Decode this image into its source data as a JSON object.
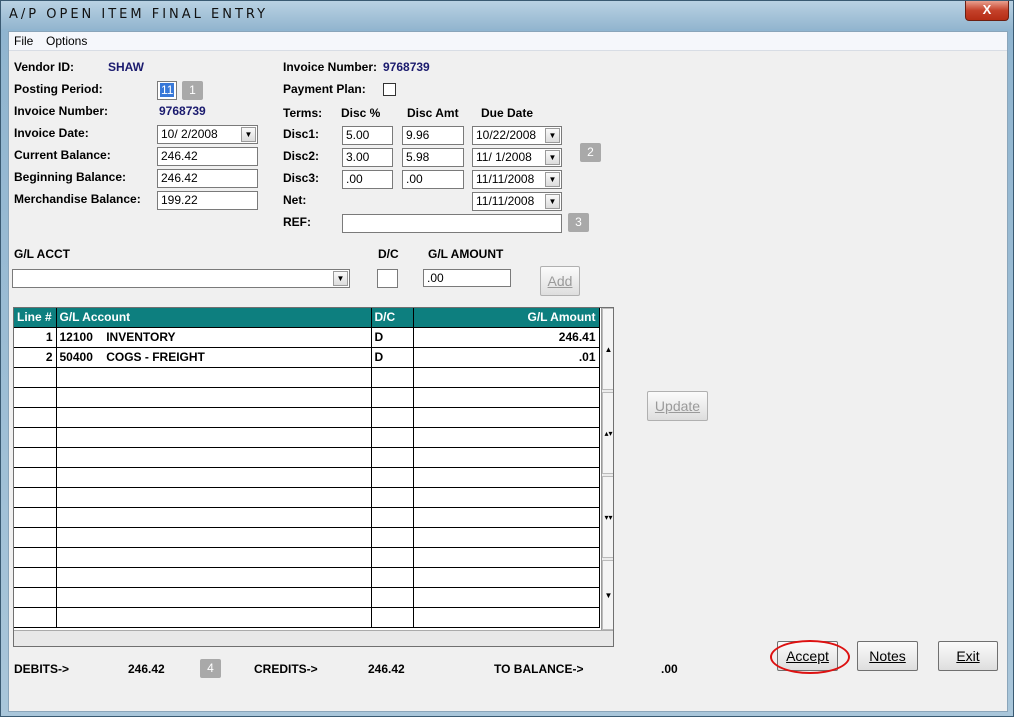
{
  "window": {
    "title": "A/P  OPEN ITEM FINAL ENTRY",
    "close_glyph": "X"
  },
  "menu": [
    "File",
    "Options"
  ],
  "header": {
    "vendor_id_label": "Vendor ID:",
    "vendor_id": "SHAW",
    "posting_period_label": "Posting Period:",
    "posting_period": "11",
    "invoice_number_label": "Invoice Number:",
    "invoice_number": "9768739",
    "invoice_date_label": "Invoice Date:",
    "invoice_date": "10/ 2/2008",
    "current_balance_label": "Current Balance:",
    "current_balance": "246.42",
    "beginning_balance_label": "Beginning Balance:",
    "beginning_balance": "246.42",
    "merch_balance_label": "Merchandise Balance:",
    "merch_balance": "199.22",
    "invoice_number_label_2": "Invoice Number:",
    "invoice_number_2": "9768739",
    "payment_plan_label": "Payment Plan:"
  },
  "terms": {
    "terms_label": "Terms:",
    "disc_pct_label": "Disc %",
    "disc_amt_label": "Disc Amt",
    "due_date_label": "Due Date",
    "rows": [
      {
        "label": "Disc1:",
        "pct": "5.00",
        "amt": "9.96",
        "due": "10/22/2008"
      },
      {
        "label": "Disc2:",
        "pct": "3.00",
        "amt": "5.98",
        "due": "11/ 1/2008"
      },
      {
        "label": "Disc3:",
        "pct": ".00",
        "amt": ".00",
        "due": "11/11/2008"
      }
    ],
    "net_label": "Net:",
    "net_due": "11/11/2008",
    "ref_label": "REF:",
    "ref_value": ""
  },
  "badges": [
    "1",
    "2",
    "3",
    "4"
  ],
  "gl_entry": {
    "acct_label": "G/L ACCT",
    "dc_label": "D/C",
    "amount_label": "G/L AMOUNT",
    "acct_value": "",
    "dc_value": "",
    "amount_value": ".00",
    "add_label": "Add"
  },
  "grid": {
    "columns": [
      "Line #",
      "G/L Account",
      "D/C",
      "G/L Amount"
    ],
    "rows": [
      {
        "line": "1",
        "account": "12100    INVENTORY",
        "dc": "D",
        "amount": "246.41"
      },
      {
        "line": "2",
        "account": "50400    COGS - FREIGHT",
        "dc": "D",
        "amount": ".01"
      }
    ]
  },
  "buttons": {
    "update": "Update",
    "accept": "Accept",
    "notes": "Notes",
    "exit": "Exit"
  },
  "totals": {
    "debits_label": "DEBITS->",
    "debits": "246.42",
    "credits_label": "CREDITS->",
    "credits": "246.42",
    "to_balance_label": "TO BALANCE->",
    "to_balance": ".00"
  },
  "colors": {
    "grid_header": "#0d7f7f",
    "highlight_ring": "#dd1111"
  }
}
